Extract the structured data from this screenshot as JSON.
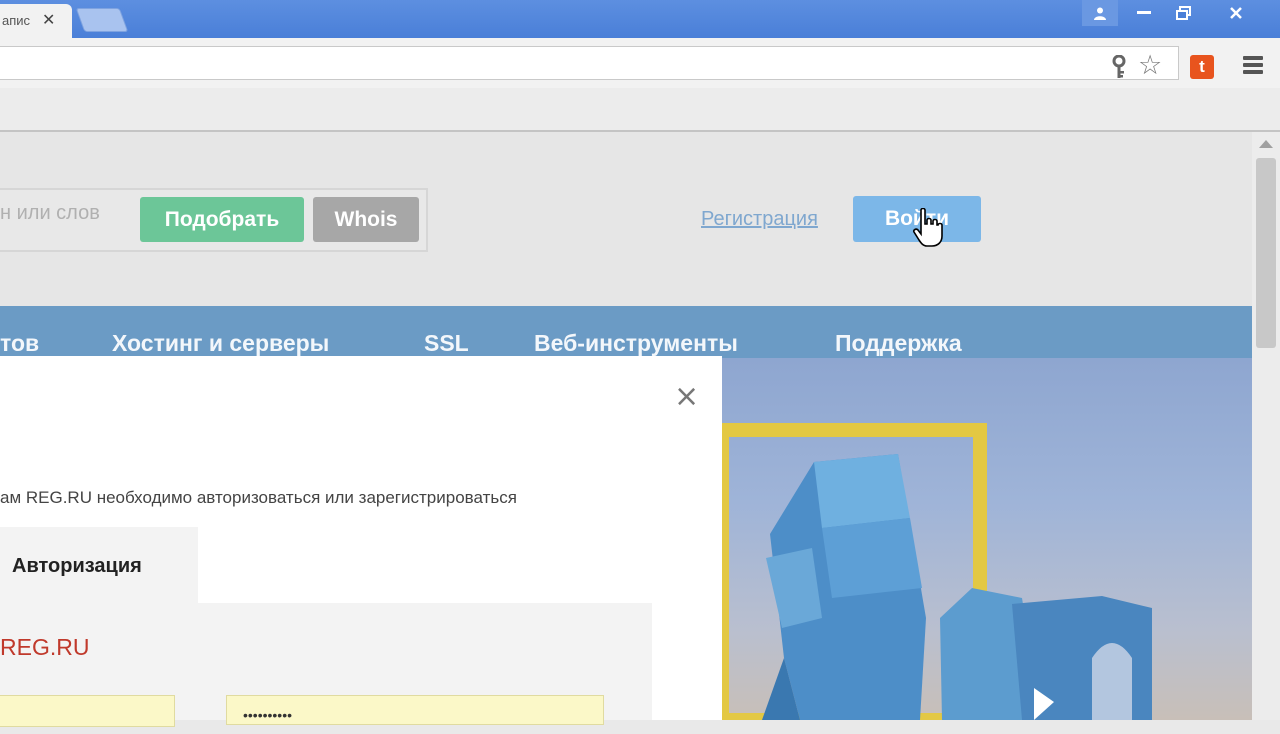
{
  "browser": {
    "tab_title": "апис",
    "tab_close": "✕",
    "window_buttons": {
      "minimize": "▬",
      "maximize": "⧉",
      "close": "✕"
    }
  },
  "header": {
    "search_placeholder": "н или слов",
    "pick_button": "Подобрать",
    "whois_button": "Whois",
    "register_link": "Регистрация",
    "login_button": "Войти"
  },
  "nav": {
    "items": [
      "тов",
      "Хостинг и серверы",
      "SSL",
      "Веб-инструменты",
      "Поддержка"
    ]
  },
  "modal": {
    "close": "×",
    "description": "ам REG.RU необходимо авторизоваться или зарегистрироваться",
    "tab_auth": "Авторизация",
    "form_title": "REG.RU",
    "password_value": "••••••••••"
  },
  "colors": {
    "titlebar": "#4a7fd8",
    "nav_bg": "#6b9bc5",
    "pick_button": "#6cc698",
    "login_button": "#7cb7e8",
    "form_title": "#c0392b"
  }
}
